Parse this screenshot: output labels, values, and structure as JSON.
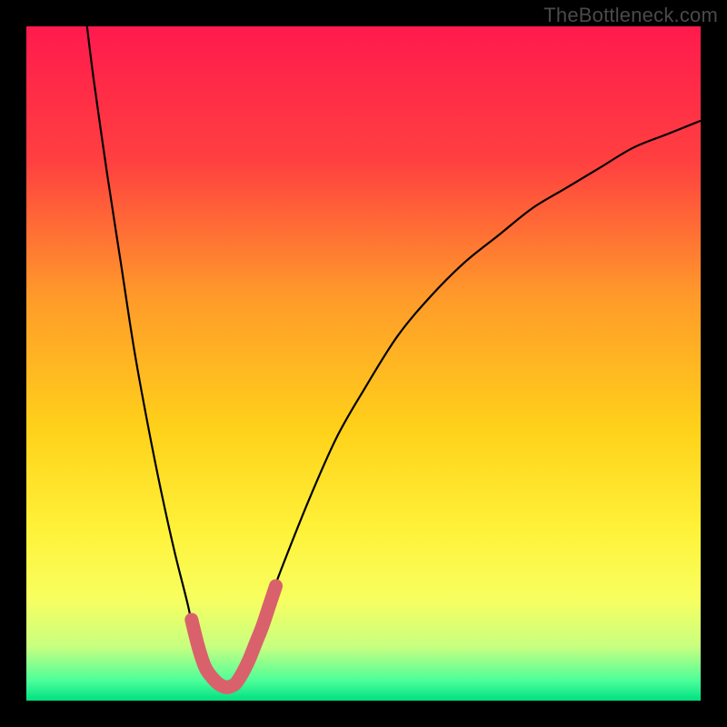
{
  "watermark": {
    "text": "TheBottleneck.com"
  },
  "chart_data": {
    "type": "line",
    "title": "",
    "xlabel": "",
    "ylabel": "",
    "xlim": [
      0,
      100
    ],
    "ylim": [
      0,
      100
    ],
    "grid": false,
    "legend": false,
    "background_gradient_stops": [
      {
        "offset": 0.0,
        "color": "#ff1a4d"
      },
      {
        "offset": 0.2,
        "color": "#ff4040"
      },
      {
        "offset": 0.4,
        "color": "#ff9a2a"
      },
      {
        "offset": 0.6,
        "color": "#ffd21a"
      },
      {
        "offset": 0.75,
        "color": "#fff23a"
      },
      {
        "offset": 0.85,
        "color": "#f7ff60"
      },
      {
        "offset": 0.92,
        "color": "#c8ff80"
      },
      {
        "offset": 0.97,
        "color": "#4dff9a"
      },
      {
        "offset": 1.0,
        "color": "#00e080"
      }
    ],
    "series": [
      {
        "name": "curve-left",
        "x": [
          9,
          10,
          12,
          14,
          16,
          18,
          20,
          22,
          24,
          25,
          26,
          27,
          28,
          29,
          30
        ],
        "y": [
          100,
          92,
          78,
          65,
          52,
          41,
          31,
          22,
          14,
          9,
          6,
          4,
          3,
          2,
          2
        ]
      },
      {
        "name": "curve-right",
        "x": [
          30,
          32,
          35,
          38,
          42,
          46,
          50,
          55,
          60,
          65,
          70,
          75,
          80,
          85,
          90,
          95,
          100
        ],
        "y": [
          2,
          5,
          12,
          20,
          30,
          39,
          46,
          54,
          60,
          65,
          69,
          73,
          76,
          79,
          82,
          84,
          86
        ]
      },
      {
        "name": "highlight-left",
        "style": "thick-pink",
        "x": [
          24.5,
          25.5,
          26.5,
          27.5,
          28.5,
          29.5,
          30.0
        ],
        "y": [
          12.0,
          8.0,
          5.0,
          3.5,
          2.5,
          2.0,
          2.0
        ]
      },
      {
        "name": "highlight-right",
        "style": "thick-pink",
        "x": [
          30.0,
          31.0,
          32.0,
          33.0,
          34.0,
          35.0,
          36.0,
          37.0
        ],
        "y": [
          2.0,
          2.5,
          4.0,
          6.0,
          8.5,
          11.0,
          14.0,
          17.0
        ]
      }
    ],
    "highlight_color": "#d9616b",
    "curve_color": "#000000"
  }
}
